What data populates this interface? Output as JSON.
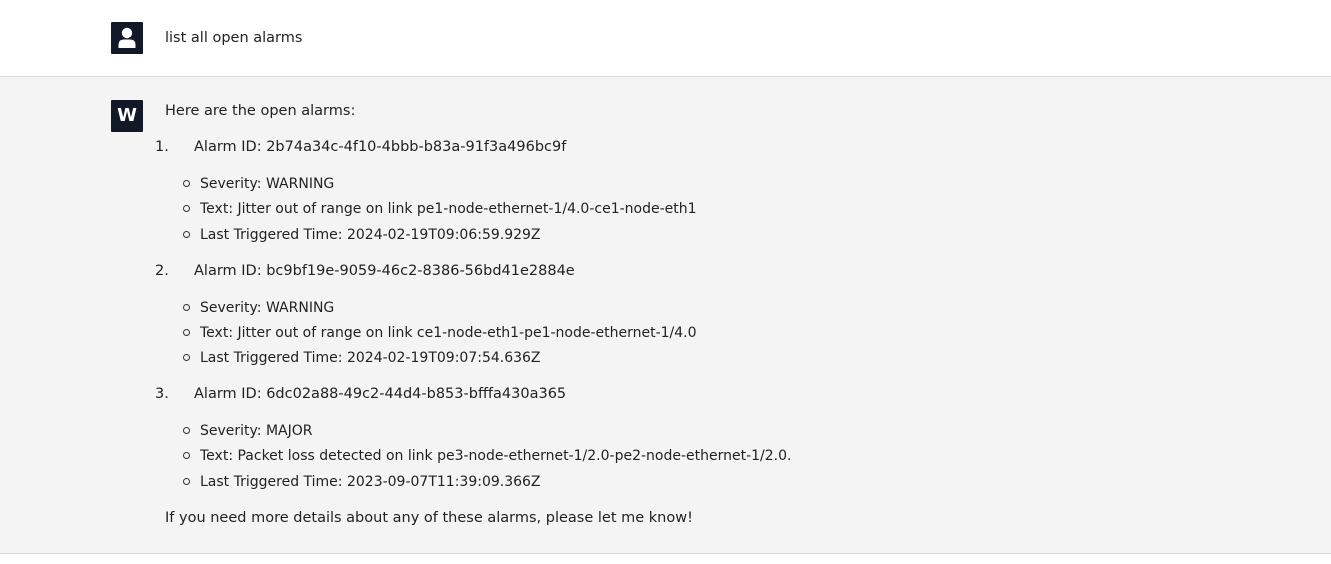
{
  "user_message": {
    "avatar_icon": "person-icon",
    "text": "list all open alarms"
  },
  "assistant_message": {
    "avatar_letter": "W",
    "intro": "Here are the open alarms:",
    "alarms": [
      {
        "number": "1.",
        "id_line": "Alarm ID: 2b74a34c-4f10-4bbb-b83a-91f3a496bc9f",
        "severity": "Severity: WARNING",
        "text": "Text: Jitter out of range on link pe1-node-ethernet-1/4.0-ce1-node-eth1",
        "last_triggered": "Last Triggered Time: 2024-02-19T09:06:59.929Z"
      },
      {
        "number": "2.",
        "id_line": "Alarm ID: bc9bf19e-9059-46c2-8386-56bd41e2884e",
        "severity": "Severity: WARNING",
        "text": "Text: Jitter out of range on link ce1-node-eth1-pe1-node-ethernet-1/4.0",
        "last_triggered": "Last Triggered Time: 2024-02-19T09:07:54.636Z"
      },
      {
        "number": "3.",
        "id_line": "Alarm ID: 6dc02a88-49c2-44d4-b853-bfffa430a365",
        "severity": "Severity: MAJOR",
        "text": "Text: Packet loss detected on link pe3-node-ethernet-1/2.0-pe2-node-ethernet-1/2.0.",
        "last_triggered": "Last Triggered Time: 2023-09-07T11:39:09.366Z"
      }
    ],
    "outro": "If you need more details about any of these alarms, please let me know!"
  }
}
